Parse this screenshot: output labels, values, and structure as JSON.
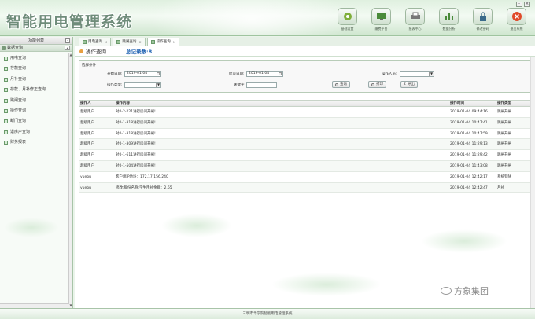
{
  "app": {
    "title": "智能用电管理系统",
    "toolbar": [
      {
        "label": "基础设置",
        "icon": "gear-icon"
      },
      {
        "label": "缴费平台",
        "icon": "monitor-icon"
      },
      {
        "label": "报表中心",
        "icon": "printer-icon"
      },
      {
        "label": "数据分析",
        "icon": "bar-chart-icon"
      },
      {
        "label": "修改密码",
        "icon": "lock-icon"
      },
      {
        "label": "退出系统",
        "icon": "exit-icon"
      }
    ]
  },
  "sidebar": {
    "header": "功能列表",
    "group": "数据查询",
    "items": [
      {
        "label": "用电查询"
      },
      {
        "label": "存款查询"
      },
      {
        "label": "月补查询"
      },
      {
        "label": "存款、月补修正查询"
      },
      {
        "label": "跳闸查询"
      },
      {
        "label": "操作查询"
      },
      {
        "label": "断门查询"
      },
      {
        "label": "退房户查询"
      },
      {
        "label": "财务报表"
      }
    ]
  },
  "tabs": [
    {
      "label": "用电查询"
    },
    {
      "label": "跳闸查询"
    },
    {
      "label": "操作查询"
    }
  ],
  "page": {
    "title": "操作查询",
    "record_count": "总记录数:8"
  },
  "filter": {
    "section_title": "选择条件",
    "start_label": "开始日期:",
    "start_value": "2019-01-04",
    "end_label": "结束日期:",
    "end_value": "2019-01-04",
    "operator_label": "操作人员:",
    "type_label": "操作类型:",
    "keyword_label": "关键字:",
    "query_btn": "查询",
    "print_btn": "打印",
    "export_btn": "导出"
  },
  "table": {
    "headers": [
      "操作人",
      "操作内容",
      "操作时间",
      "操作类型"
    ],
    "rows": [
      [
        "超级用户",
        "对0-2-221进行房间开闸!",
        "2019-01-04 09:44:16",
        "跳闸开闸"
      ],
      [
        "超级用户",
        "对0-1-318进行房间开闸!",
        "2019-01-04 10:47:41",
        "跳闸开闸"
      ],
      [
        "超级用户",
        "对0-1-318进行房间开闸!",
        "2019-01-04 10:47:59",
        "跳闸开闸"
      ],
      [
        "超级用户",
        "对0-1-309进行房间开闸!",
        "2019-01-04 11:29:13",
        "跳闸开闸"
      ],
      [
        "超级用户",
        "对0-1-611进行房间开闸!",
        "2019-01-04 11:29:42",
        "跳闸开闸"
      ],
      [
        "超级用户",
        "对0-1-504进行房间开闸!",
        "2019-01-04 11:43:08",
        "跳闸开闸"
      ],
      [
        "yuebu",
        "客户端IP地址：172.17.156.240",
        "2019-01-04 12:42:17",
        "系统登陆"
      ],
      [
        "yuebu",
        "修改:每份名称:学生用补金额：2.65",
        "2019-01-04 12:42:47",
        "月补"
      ]
    ]
  },
  "footer": {
    "text": "三明市华学院智能用电管理系统"
  },
  "watermark": {
    "text": "方象集团"
  }
}
